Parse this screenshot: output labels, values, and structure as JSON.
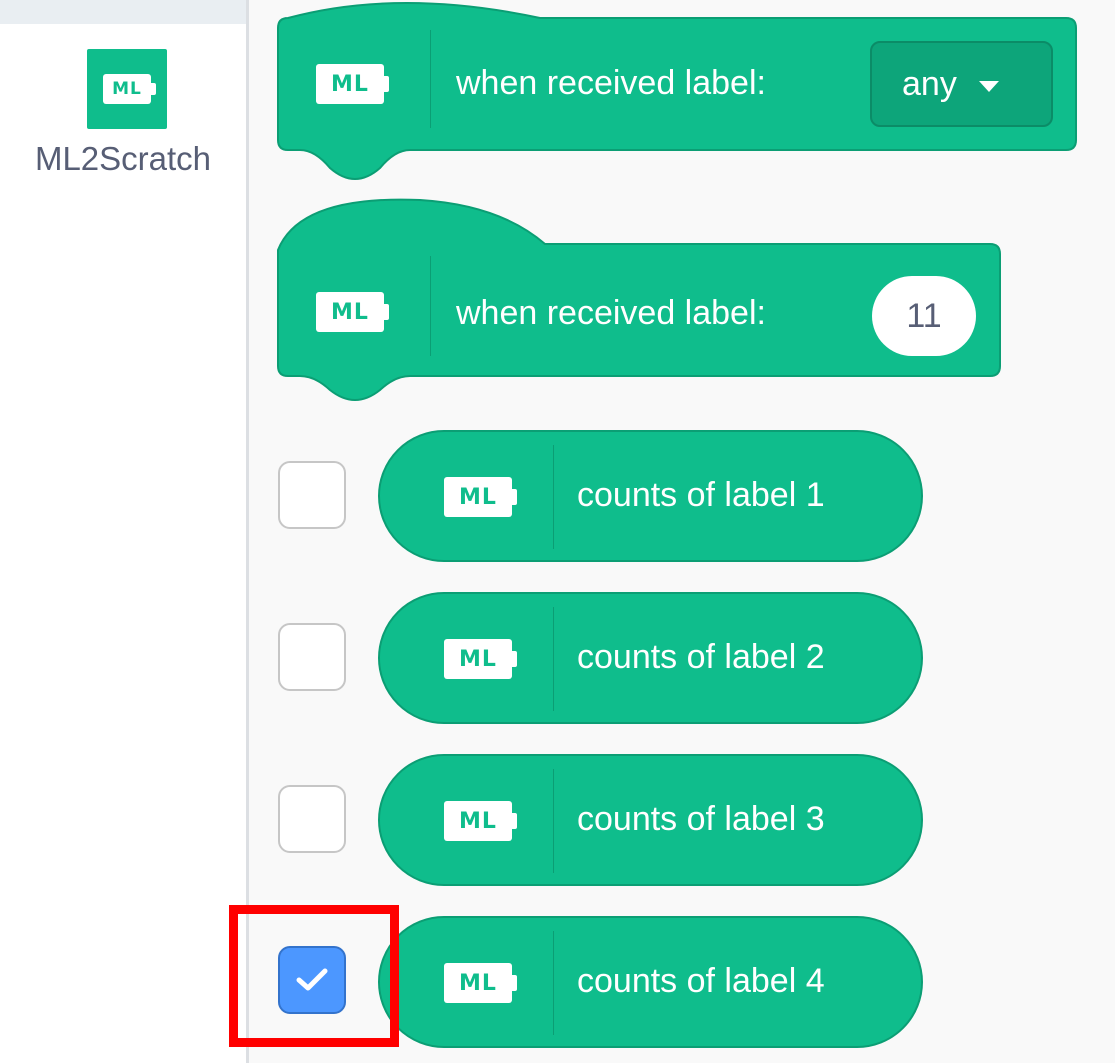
{
  "category": {
    "icon": "ml-logo-icon",
    "icon_text": "ML",
    "label": "ML2Scratch"
  },
  "hat_blocks": [
    {
      "text": "when received label:",
      "logo": "ML",
      "field_kind": "dropdown",
      "field_value": "any"
    },
    {
      "text": "when received label:",
      "logo": "ML",
      "field_kind": "number-input",
      "field_value": "11"
    }
  ],
  "reporters": [
    {
      "text": "counts of label 1",
      "logo": "ML",
      "checked": false
    },
    {
      "text": "counts of label 2",
      "logo": "ML",
      "checked": false
    },
    {
      "text": "counts of label 3",
      "logo": "ML",
      "checked": false
    },
    {
      "text": "counts of label 4",
      "logo": "ML",
      "checked": true
    }
  ],
  "colors": {
    "block": "#0fbd8c",
    "block_border": "#0b9e74",
    "checkbox_checked": "#4c97ff",
    "highlight": "#ff0000",
    "category_label": "#575e75"
  }
}
